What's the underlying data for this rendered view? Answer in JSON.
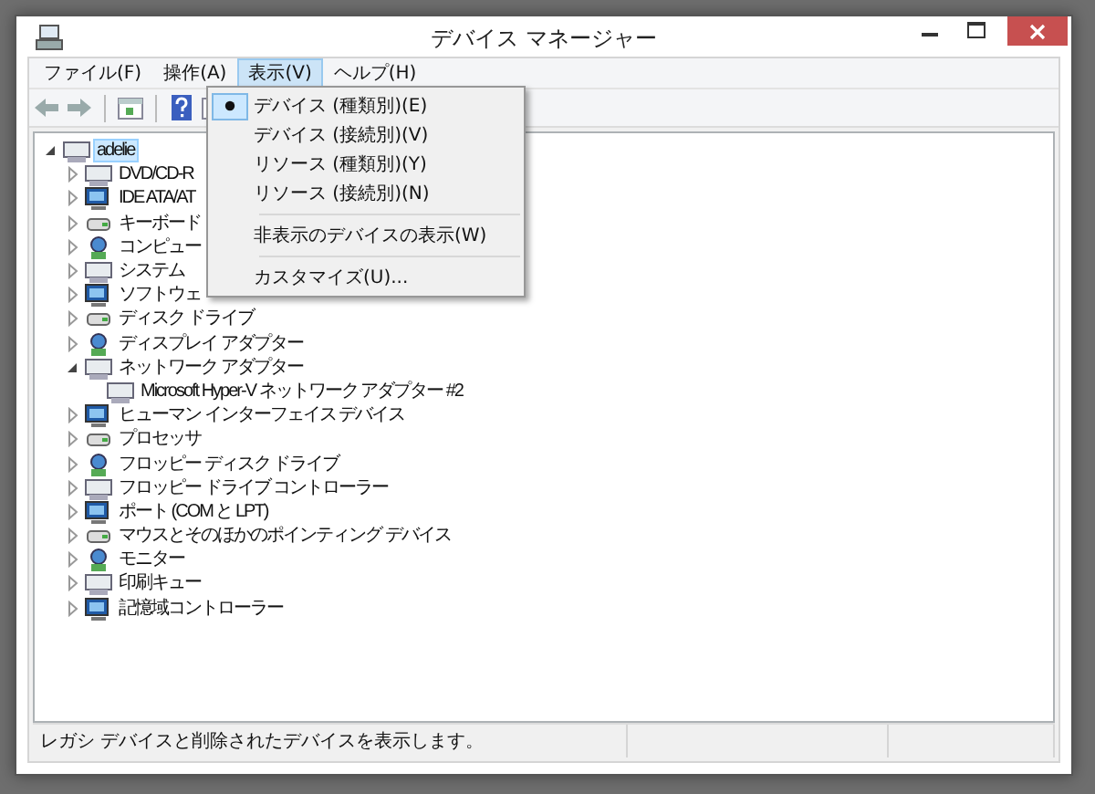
{
  "window": {
    "title": "デバイス マネージャー"
  },
  "menu_bar": [
    {
      "label": "ファイル(F)",
      "selected": false
    },
    {
      "label": "操作(A)",
      "selected": false
    },
    {
      "label": "表示(V)",
      "selected": true
    },
    {
      "label": "ヘルプ(H)",
      "selected": false
    }
  ],
  "view_menu": [
    {
      "label": "デバイス (種類別)(E)",
      "checked": true,
      "separator_before": false
    },
    {
      "label": "デバイス (接続別)(V)",
      "checked": false,
      "separator_before": false
    },
    {
      "label": "リソース (種類別)(Y)",
      "checked": false,
      "separator_before": false
    },
    {
      "label": "リソース (接続別)(N)",
      "checked": false,
      "separator_before": false
    },
    {
      "label": "非表示のデバイスの表示(W)",
      "checked": false,
      "separator_before": true
    },
    {
      "label": "カスタマイズ(U)...",
      "checked": false,
      "separator_before": true
    }
  ],
  "tree": {
    "label": "adelie",
    "expanded": true,
    "selected": true,
    "children": [
      {
        "label": "DVD/CD-R",
        "expanded": false
      },
      {
        "label": "IDE ATA/AT",
        "expanded": false
      },
      {
        "label": "キーボード",
        "expanded": false
      },
      {
        "label": "コンピュー",
        "expanded": false
      },
      {
        "label": "システム",
        "expanded": false
      },
      {
        "label": "ソフトウェ",
        "expanded": false
      },
      {
        "label": "ディスク ドライブ",
        "expanded": false
      },
      {
        "label": "ディスプレイ アダプター",
        "expanded": false
      },
      {
        "label": "ネットワーク アダプター",
        "expanded": true,
        "children": [
          {
            "label": "Microsoft Hyper-V ネットワーク アダプター #2"
          }
        ]
      },
      {
        "label": "ヒューマン インターフェイス デバイス",
        "expanded": false
      },
      {
        "label": "プロセッサ",
        "expanded": false
      },
      {
        "label": "フロッピー ディスク ドライブ",
        "expanded": false
      },
      {
        "label": "フロッピー ドライブ コントローラー",
        "expanded": false
      },
      {
        "label": "ポート (COM と LPT)",
        "expanded": false
      },
      {
        "label": "マウスとそのほかのポインティング デバイス",
        "expanded": false
      },
      {
        "label": "モニター",
        "expanded": false
      },
      {
        "label": "印刷キュー",
        "expanded": false
      },
      {
        "label": "記憶域コントローラー",
        "expanded": false
      }
    ]
  },
  "status_bar": {
    "text": "レガシ デバイスと削除されたデバイスを表示します。"
  }
}
